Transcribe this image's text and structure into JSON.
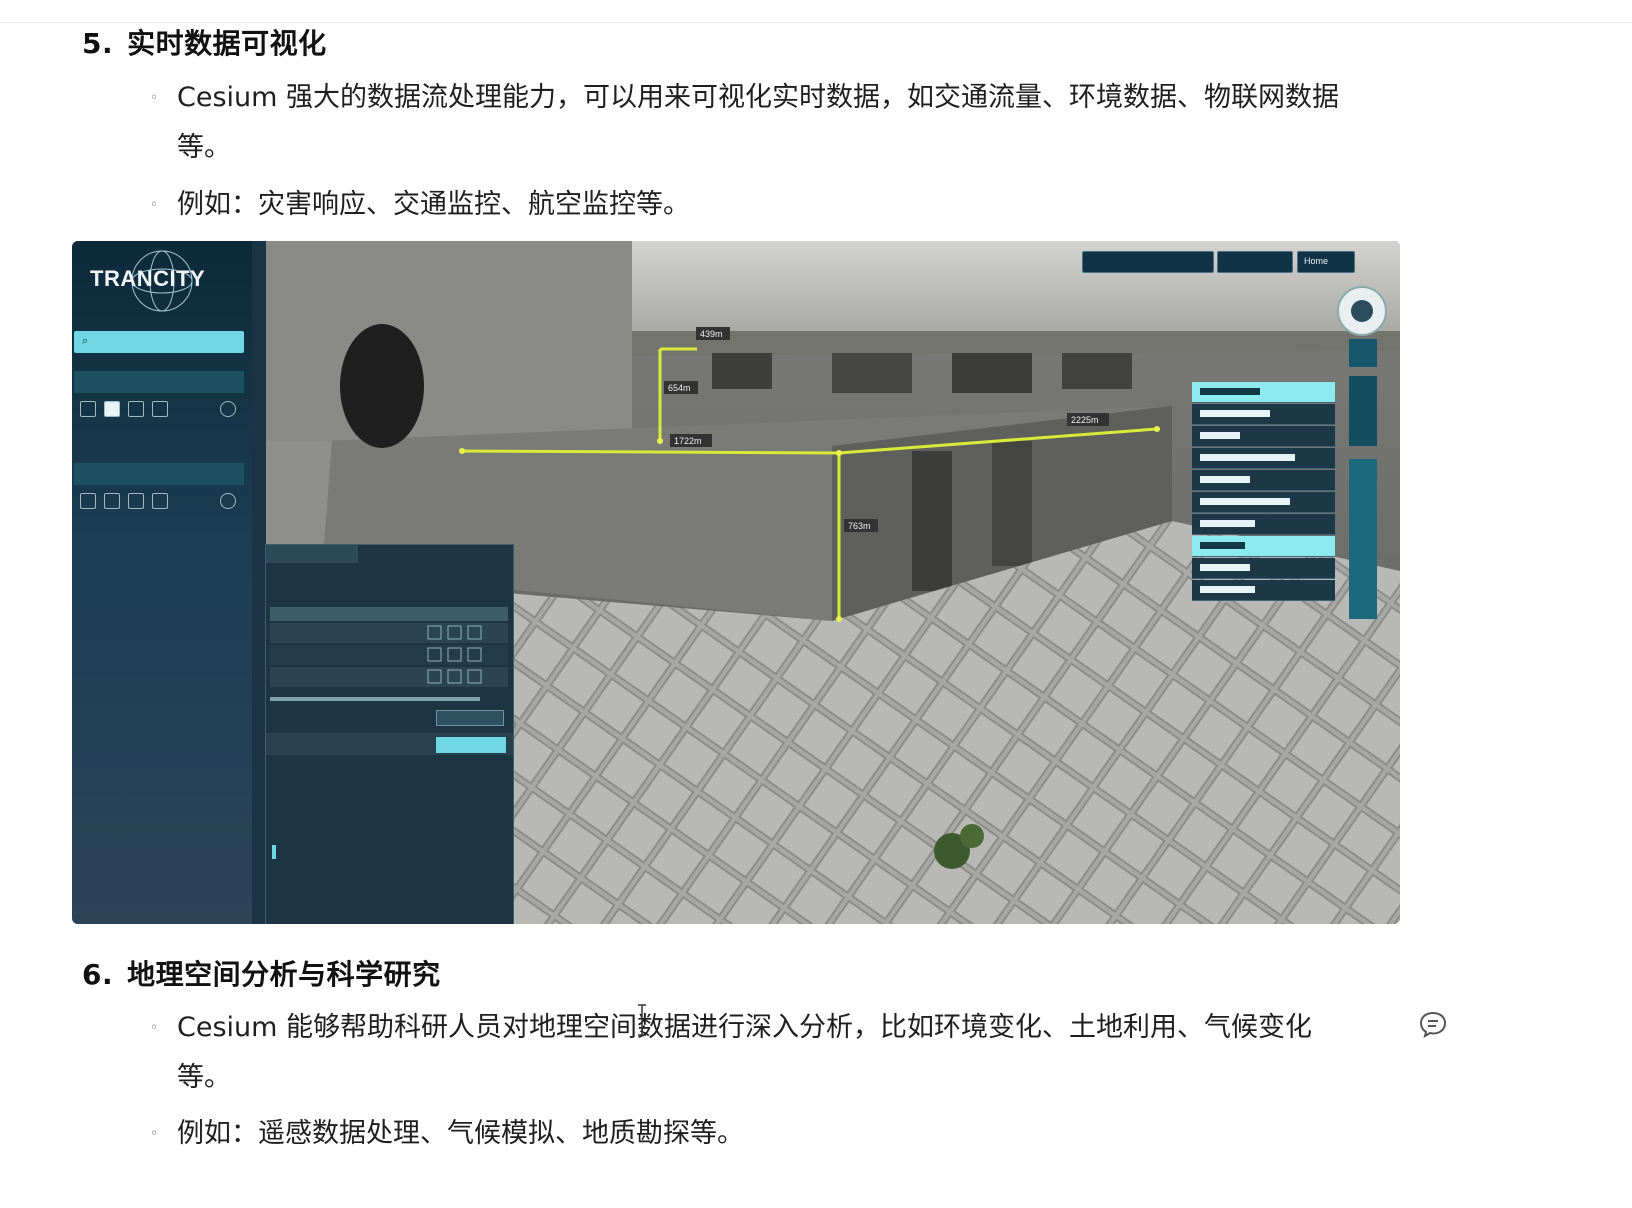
{
  "section5": {
    "number": "5.",
    "title": "实时数据可视化",
    "bullets": [
      "Cesium 强大的数据流处理能力，可以用来可视化实时数据，如交通流量、环境数据、物联网数据",
      "等。",
      "例如：灾害响应、交通监控、航空监控等。"
    ]
  },
  "embedded_image": {
    "logo_text": "TRANCITY",
    "top_buttons": [
      "Home"
    ],
    "measurements": [
      "439m",
      "654m",
      "1722m",
      "2225m",
      "763m"
    ]
  },
  "section6": {
    "number": "6.",
    "title": "地理空间分析与科学研究",
    "bullets": [
      "Cesium 能够帮助科研人员对地理空间数据进行深入分析，比如环境变化、土地利用、气候变化",
      "等。",
      "例如：遥感数据处理、气候模拟、地质勘探等。"
    ]
  },
  "icons": {
    "comment": "comment-icon",
    "cursor": "text-cursor-icon"
  }
}
